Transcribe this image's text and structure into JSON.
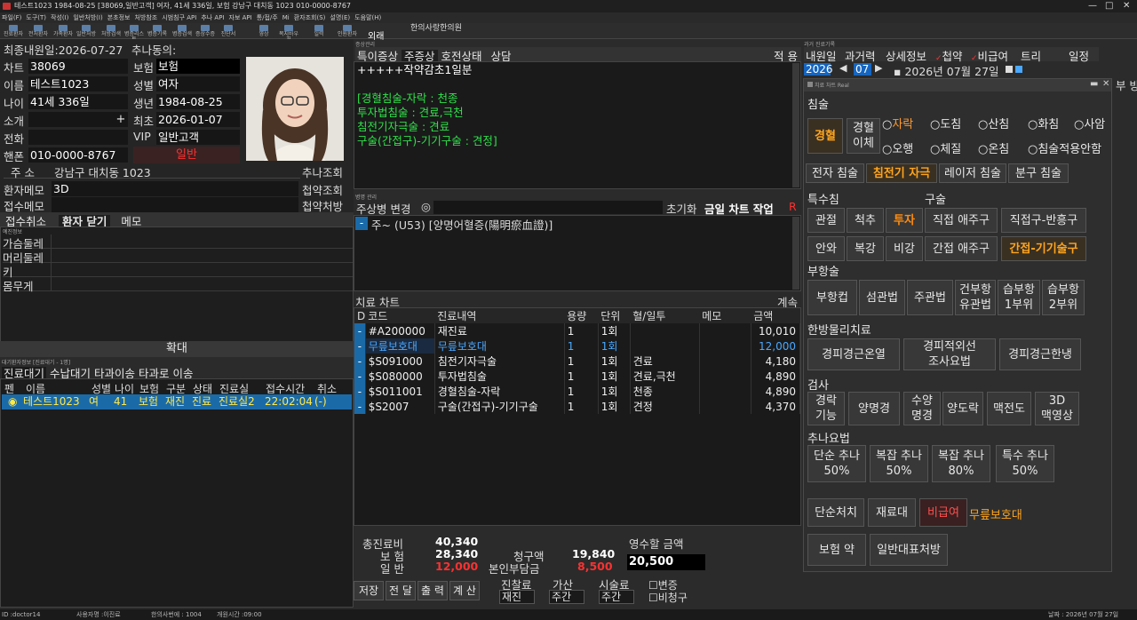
{
  "window": {
    "title": "테스트1023 1984-08-25 [38069,일반고객] 여자, 41세 336일, 보험 강남구 대치동 1023 010-0000-8767",
    "min": "—",
    "max": "□",
    "close": "✕"
  },
  "menu": [
    "파일(F)",
    "도구(T)",
    "작성(I)",
    "일반처방(I)",
    "본초정보",
    "처방참조",
    "시범침구 API",
    "추나 API",
    "자보 API",
    "통/접/주",
    "Mi",
    "환자조회(S)",
    "설명(E)",
    "도움말(H)"
  ],
  "toolbar": {
    "buttons": [
      "진료환자",
      "전처환자",
      "가족환자",
      "일반처방",
      "처방검색",
      "병증리스트",
      "병증기록",
      "병증검색",
      "증상수증",
      "진단서",
      "영상",
      "복지바우처",
      "일력",
      "인원환자"
    ],
    "clinic": "한의사랑한의원",
    "waegae": "외래"
  },
  "patient": {
    "last_visit_label": "최종내원일:2026-07-27",
    "chuna_label": "추나동의:",
    "chart_label": "차트",
    "chart": "38069",
    "insurance_label": "보험",
    "insurance": "보험",
    "name_label": "이름",
    "name": "테스트1023",
    "sex_label": "성별",
    "sex": "여자",
    "age_label": "나이",
    "age": "41세 336일",
    "birth_label": "생년",
    "birth": "1984-08-25",
    "intro_label": "소개",
    "intro": "",
    "plus": "+",
    "first_label": "최초",
    "first": "2026-01-07",
    "phone_label": "전화",
    "phone": "",
    "vip_label": "VIP",
    "vip": "일반고객",
    "mobile_label": "핸폰",
    "mobile": "010-0000-8767",
    "general": "일반",
    "addr_label": "주 소",
    "addr": "강남구 대치동 1023",
    "chuna_lookup": "추나조회",
    "memo_label": "환자메모",
    "memo": "3D",
    "chup_lookup": "첩약조회",
    "reception_memo_label": "접수메모",
    "reception_memo": "",
    "chup_rx": "첩약처방",
    "tabs": [
      "접수취소",
      "환자 닫기",
      "메모"
    ],
    "vitals_title": "예진정보",
    "vitals": [
      "가슴둘레",
      "머리둘레",
      "키",
      "몸무게"
    ]
  },
  "waiting": {
    "expand": "확대",
    "section": "대기환자정보 [진료대기 - 1명]",
    "tabs": [
      "진료대기",
      "수납대기",
      "타과이송",
      "타과로 이송"
    ],
    "headers": [
      "펜",
      "이름",
      "성별",
      "나이",
      "보험",
      "구분",
      "상태",
      "진료실",
      "접수시간",
      "취소"
    ],
    "rows": [
      {
        "pen": "◉",
        "name": "테스트1023",
        "sex": "여",
        "age": "41",
        "ins": "보험",
        "kind": "재진",
        "state": "진료",
        "room": "진료실2",
        "time": "22:02:04",
        "cancel": "(-)"
      }
    ]
  },
  "symptom": {
    "section": "증상관리",
    "tabs": [
      "특이증상",
      "주증상",
      "호전상태",
      "상담"
    ],
    "right": "적 용",
    "lines": [
      "+++++작약감초1일분",
      "",
      "[경혈침술-자락 : 천종",
      "투자법침술 : 견료,극천",
      "침전기자극술 : 견료",
      "구술(간접구)-기기구술 : 견정]"
    ]
  },
  "disease": {
    "section": "병명 관리",
    "change": "주상병 변경",
    "radio": "◎",
    "reset": "초기화",
    "today_chart": "금일 차트 작업",
    "r": "R",
    "minus": "-",
    "code": "주~ (U53) [양명어혈증(陽明瘀血證)]"
  },
  "chart": {
    "title": "치료 차트",
    "continue": "계속",
    "headers": [
      "D",
      "코드",
      "진료내역",
      "용량",
      "단위",
      "혈/일투",
      "메모",
      "금액"
    ],
    "rows": [
      {
        "d": "-",
        "code": "#A200000",
        "desc": "재진료",
        "qty": "1",
        "unit": "1회",
        "hyul": "",
        "memo": "",
        "amt": "10,010",
        "c": "w"
      },
      {
        "d": "-",
        "code": "무릎보호대",
        "desc": "무릎보호대",
        "qty": "1",
        "unit": "1회",
        "hyul": "",
        "memo": "",
        "amt": "12,000",
        "c": "b"
      },
      {
        "d": "-",
        "code": "$S091000",
        "desc": "침전기자극술",
        "qty": "1",
        "unit": "1회",
        "hyul": "견료",
        "memo": "",
        "amt": "4,180",
        "c": "w"
      },
      {
        "d": "-",
        "code": "$S080000",
        "desc": "투자법침술",
        "qty": "1",
        "unit": "1회",
        "hyul": "견료,극천",
        "memo": "",
        "amt": "4,890",
        "c": "w"
      },
      {
        "d": "-",
        "code": "$S011001",
        "desc": "경혈침술-자락",
        "qty": "1",
        "unit": "1회",
        "hyul": "천종",
        "memo": "",
        "amt": "4,890",
        "c": "w"
      },
      {
        "d": "-",
        "code": "$S2007",
        "desc": "구술(간접구)-기기구술",
        "qty": "1",
        "unit": "1회",
        "hyul": "견정",
        "memo": "",
        "amt": "4,370",
        "c": "w"
      }
    ]
  },
  "totals": {
    "total_label": "총진료비",
    "total": "40,340",
    "ins_label": "보 험",
    "ins": "28,340",
    "gen_label": "일 반",
    "gen": "12,000",
    "claim_label": "청구액",
    "claim": "19,840",
    "self_label": "본인부담금",
    "self": "8,500",
    "receipt_label": "영수할 금액",
    "receipt": "20,500",
    "buttons": [
      "저장",
      "전 달",
      "출 력",
      "계 산"
    ],
    "fee_label": "진찰료",
    "fee": "재진",
    "add_label": "가산",
    "add": "주간",
    "proc_label": "시술료",
    "proc": "주간",
    "chk1": "변증",
    "chk2": "비청구"
  },
  "history": {
    "section": "과거 진료기록",
    "tabs": [
      "내원일",
      "과거력",
      "상세정보",
      "첩약",
      "비급여",
      "트리",
      "일정"
    ],
    "year": "2026",
    "month": "07",
    "date": "2026년 07월 27일",
    "sidebar": "부 방"
  },
  "treat": {
    "window_title": "치료 차트 Real",
    "chim": "침술",
    "gyunghyul": "경혈",
    "gyunghyul2": "경혈\n이체",
    "radios": [
      "자락",
      "도침",
      "산침",
      "화침",
      "사암",
      "오행",
      "체질",
      "온침",
      "침술적용안함"
    ],
    "chim_tabs": [
      "전자 침술",
      "침전기 자극",
      "레이저 침술",
      "분구 침술"
    ],
    "teuk": "특수침",
    "gu": "구술",
    "teuk_btns": [
      "관절",
      "척추",
      "투자",
      "안와",
      "복강",
      "비강"
    ],
    "gu_btns": [
      "직접 애주구",
      "직접구-반흥구",
      "간접 애주구",
      "간접-기기술구"
    ],
    "buhang": "부항술",
    "buhang_btns": [
      "부항컵",
      "섬관법",
      "주관법",
      "건부항\n유관법",
      "습부항\n1부위",
      "습부항\n2부위"
    ],
    "physio": "한방물리치료",
    "physio_btns": [
      "경피경근온열",
      "경피적외선\n조사요법",
      "경피경근한냉"
    ],
    "test": "검사",
    "test_btns": [
      "경락\n기능",
      "양명경",
      "수양\n명경",
      "양도락",
      "맥전도",
      "3D\n맥영상"
    ],
    "chuna": "추나요법",
    "chuna_btns": [
      "단순 추나\n50%",
      "복잡 추나\n50%",
      "복잡 추나\n80%",
      "특수 추나\n50%"
    ],
    "misc_btns": [
      "단순처치",
      "재료대",
      "비급여"
    ],
    "misc_text": "무릎보호대",
    "misc2": [
      "보험 약",
      "일반대표처방"
    ]
  },
  "status": {
    "id": "ID :doctor14",
    "user": "사용자명 :이진료",
    "visits": "한의사번에 : 1004",
    "open": "개원시간 :09:00",
    "date": "날짜 : 2026년 07월 27일"
  },
  "colors": {
    "accent": "#ffa51e",
    "green": "#2fe04a",
    "blue": "#4aa8ff",
    "red": "#ff3030"
  }
}
